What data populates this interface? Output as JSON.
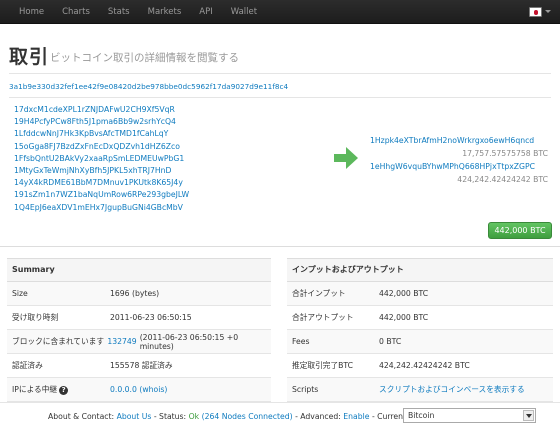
{
  "nav": {
    "items": [
      {
        "label": "Home"
      },
      {
        "label": "Charts"
      },
      {
        "label": "Stats"
      },
      {
        "label": "Markets"
      },
      {
        "label": "API"
      },
      {
        "label": "Wallet"
      }
    ],
    "language_flag_icon": "japan-flag-icon"
  },
  "page": {
    "title": "取引",
    "subtitle": "ビットコイン取引の詳細情報を閲覧する",
    "tx_hash": "3a1b9e330d32fef1ee42f9e08420d2be978bbe0dc5962f17da9027d9e11f8c4"
  },
  "inputs": [
    "17dxcM1cdeXPL1rZNJDAFwU2CH9Xf5VqR",
    "19H4PcfyPCw8Fth5J1pma6Bb9w2srhYcQ4",
    "1LfddcwNnJ7Hk3KpBvsAfcTMD1fCahLqY",
    "15oGga8FJ7BzdZxFnEcDxQDZvh1dHZ6Zco",
    "1FfsbQntU2BAkVy2xaaRpSmLEDMEUwPbG1",
    "1MtyGxTeWmjNhXyBfh5JPKL5xhTRJ7HnD",
    "14yX4kRDME61BbM7DMnuv1PKUtk8K65J4y",
    "191sZm1n7WZ1baNqUmRow6RPe293gbeJLW",
    "1Q4EpJ6eaXDV1mEHx7JgupBuGNi4GBcMbV"
  ],
  "outputs": [
    {
      "address": "1Hzpk4eXTbrAfmH2noWrkrgxo6ewH6qncd",
      "amount": "17,757.57575758 BTC"
    },
    {
      "address": "1eHhgW6vquBYhwMPhQ668HPjxTtpxZGPC",
      "amount": "424,242.42424242 BTC"
    }
  ],
  "total_button": "442,000 BTC",
  "summary": {
    "header": "Summary",
    "rows": [
      {
        "label": "Size",
        "value": "1696 (bytes)"
      },
      {
        "label": "受け取り時刻",
        "value": "2011-06-23 06:50:15"
      },
      {
        "label": "ブロックに含まれています",
        "block_link": "132749",
        "value": "(2011-06-23 06:50:15 +0 minutes)"
      },
      {
        "label": "認証済み",
        "value": "155578 認証済み"
      },
      {
        "label": "IPによる中継",
        "value": "0.0.0.0 (whois)"
      }
    ]
  },
  "io": {
    "header": "インプットおよびアウトプット",
    "rows": [
      {
        "label": "合計インプット",
        "value": "442,000 BTC"
      },
      {
        "label": "合計アウトプット",
        "value": "442,000 BTC"
      },
      {
        "label": "Fees",
        "value": "0 BTC"
      },
      {
        "label": "推定取引完了BTC",
        "value": "424,242.42424242 BTC"
      },
      {
        "label": "Scripts",
        "value": "スクリプトおよびコインベースを表示する"
      }
    ]
  },
  "footer": {
    "prefix": "About & Contact:",
    "about_link": "About Us",
    "status_label": "- Status:",
    "status_ok": "Ok",
    "nodes_link": "(264 Nodes Connected)",
    "advanced_label": "- Advanced:",
    "advanced_link": "Enable",
    "currency_label": "- Currency:",
    "currency_value": "Bitcoin"
  }
}
